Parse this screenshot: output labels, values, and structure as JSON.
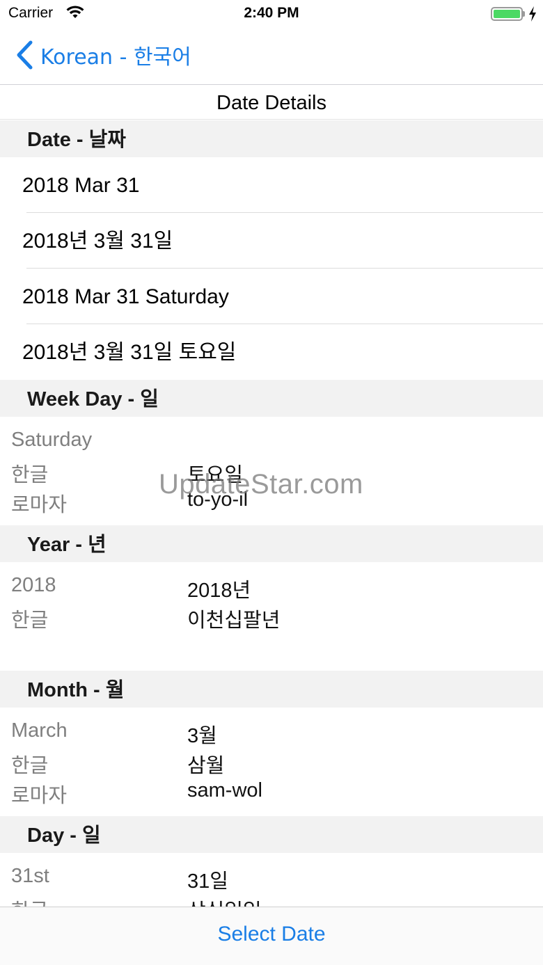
{
  "status_bar": {
    "carrier": "Carrier",
    "time": "2:40 PM",
    "battery_level": 1.0,
    "battery_color": "#4cd964",
    "wifi_icon": "wifi-icon",
    "charging_icon": "bolt-icon"
  },
  "nav": {
    "back_label": "Korean - 한국어",
    "back_icon": "chevron-left-icon",
    "accent_color": "#1a7ee6"
  },
  "title": "Date Details",
  "sections": {
    "date": {
      "header": "Date - 날짜",
      "rows": [
        "2018 Mar 31",
        "2018년 3월 31일",
        "2018 Mar 31 Saturday",
        "2018년 3월 31일 토요일"
      ]
    },
    "weekday": {
      "header": "Week Day - 일",
      "rows": [
        {
          "key": "Saturday",
          "value": ""
        },
        {
          "key": "한글",
          "value": "토요일"
        },
        {
          "key": "로마자",
          "value": "to-yo-il"
        }
      ]
    },
    "year": {
      "header": "Year - 년",
      "rows": [
        {
          "key": "2018",
          "value": "2018년"
        },
        {
          "key": "한글",
          "value": "이천십팔년"
        }
      ]
    },
    "month": {
      "header": "Month - 월",
      "rows": [
        {
          "key": "March",
          "value": "3월"
        },
        {
          "key": "한글",
          "value": "삼월"
        },
        {
          "key": "로마자",
          "value": "sam-wol"
        }
      ]
    },
    "day": {
      "header": "Day - 일",
      "rows": [
        {
          "key": "31st",
          "value": "31일"
        },
        {
          "key": "한글",
          "value": "삼십일일"
        }
      ]
    }
  },
  "watermark": "UpdateStar.com",
  "toolbar": {
    "select_date_label": "Select Date"
  }
}
